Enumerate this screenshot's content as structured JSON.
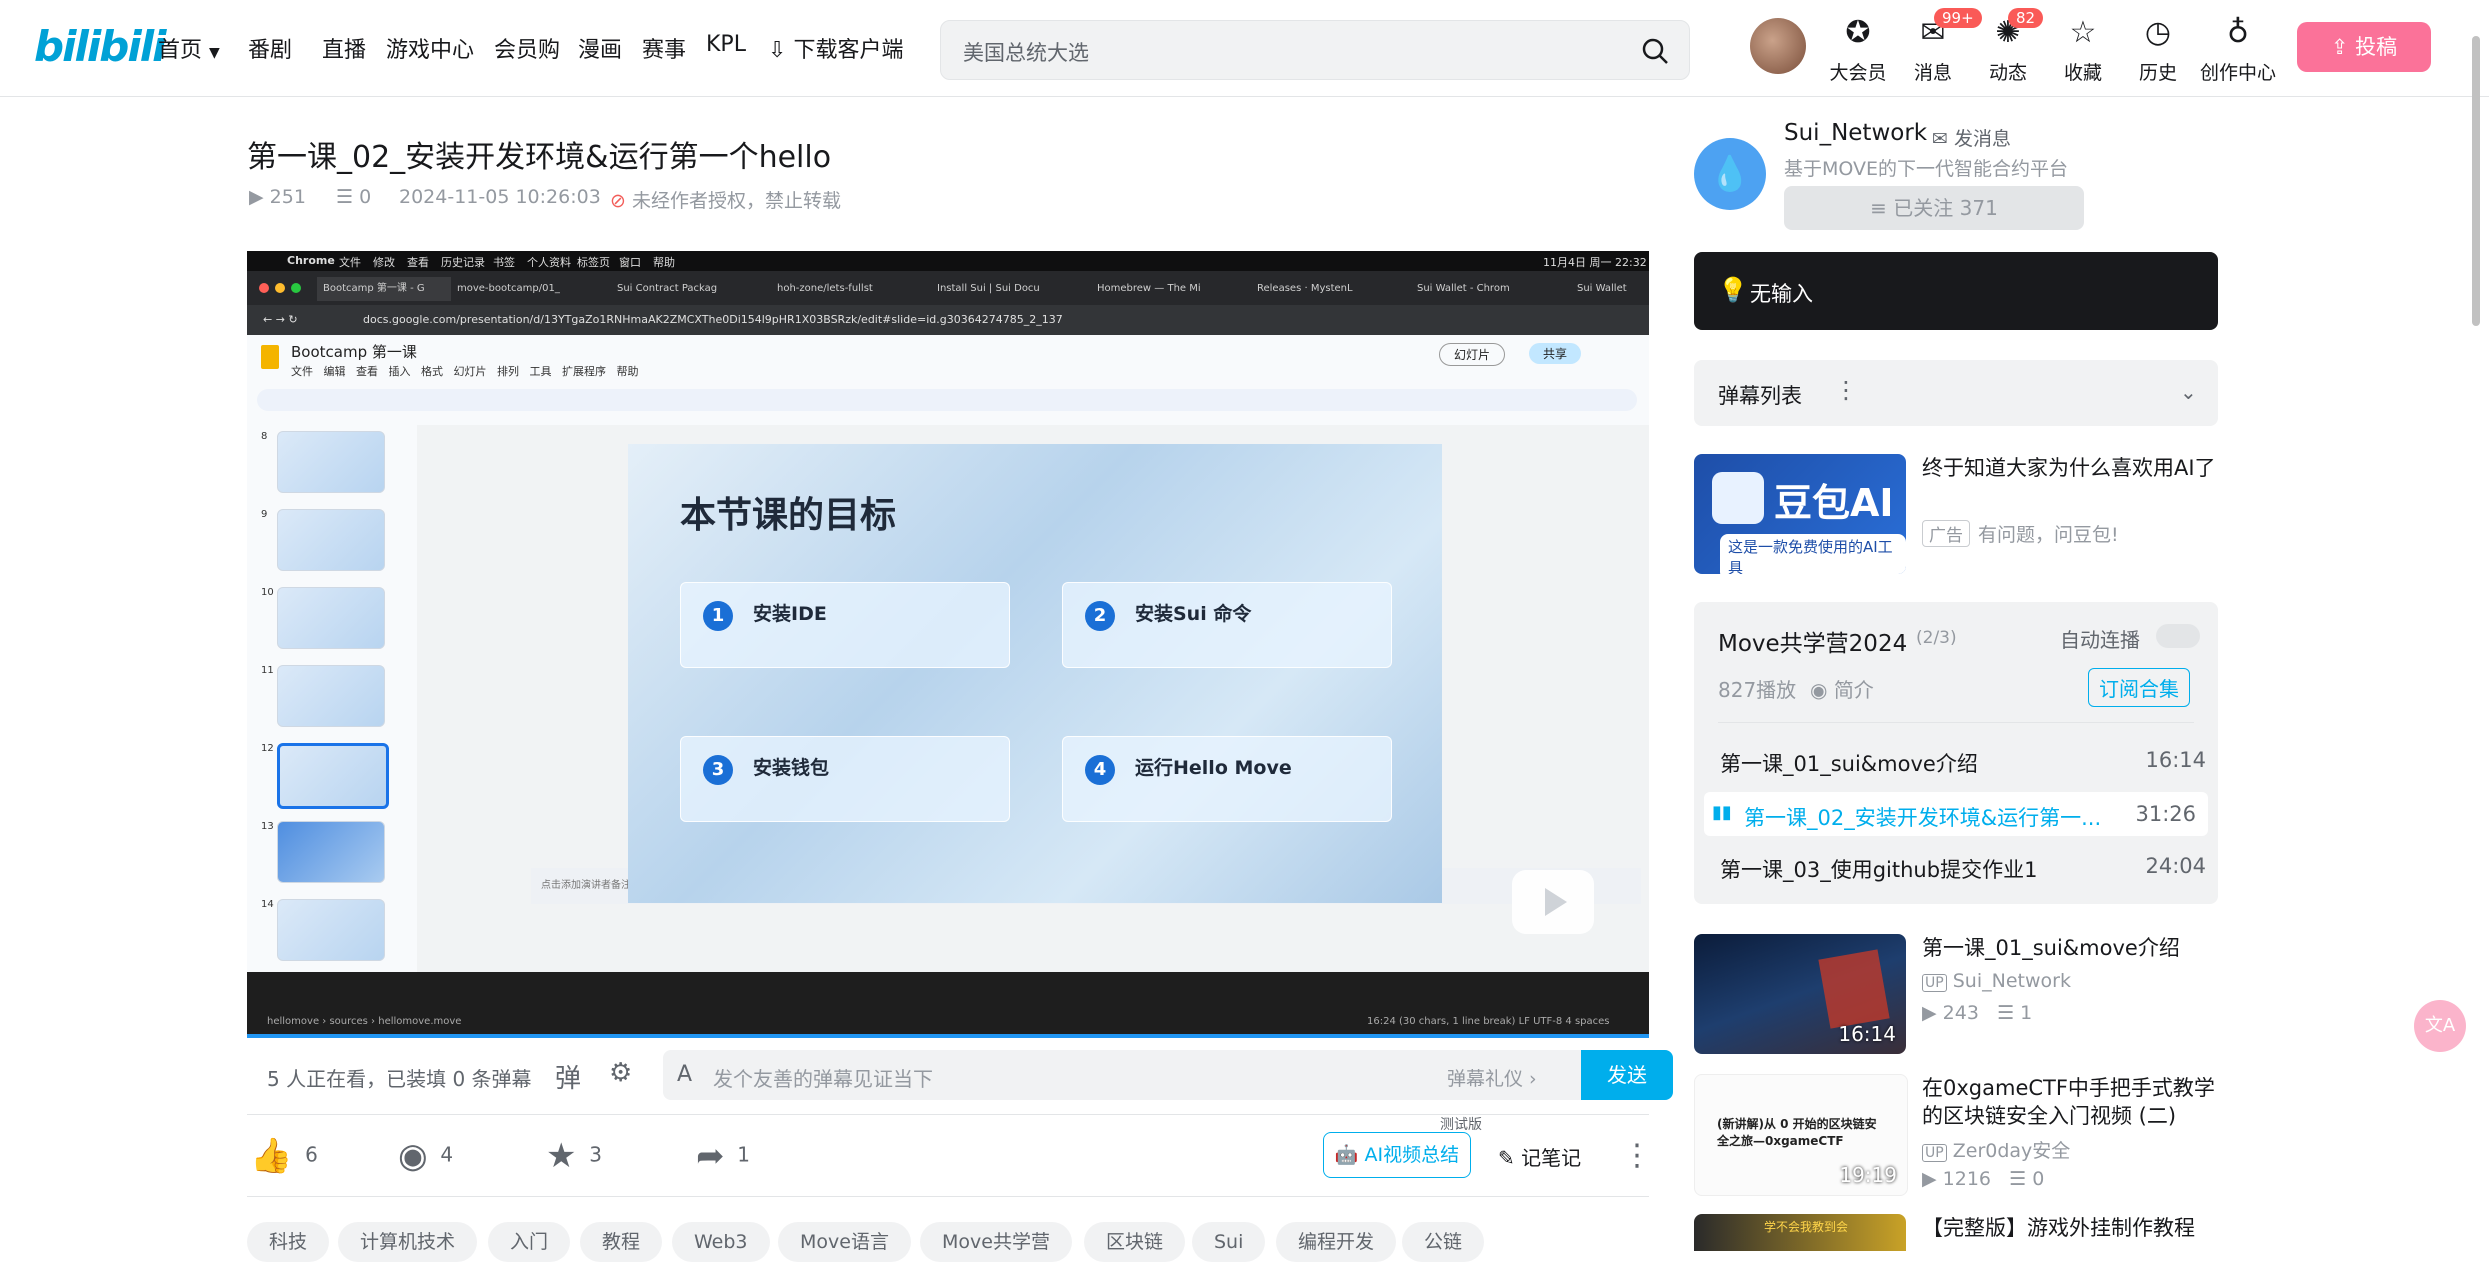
{
  "header": {
    "logo": "bilibili",
    "nav": [
      "首页",
      "番剧",
      "直播",
      "游戏中心",
      "会员购",
      "漫画",
      "赛事",
      "KPL",
      "下载客户端"
    ],
    "search_placeholder": "美国总统大选",
    "icons": [
      {
        "label": "大会员",
        "icon": "vip-icon"
      },
      {
        "label": "消息",
        "icon": "message-icon",
        "badge": "99+"
      },
      {
        "label": "动态",
        "icon": "dynamic-icon",
        "badge": "82"
      },
      {
        "label": "收藏",
        "icon": "star-icon"
      },
      {
        "label": "历史",
        "icon": "history-icon"
      },
      {
        "label": "创作中心",
        "icon": "creator-icon"
      }
    ],
    "upload_label": "投稿"
  },
  "video": {
    "title": "第一课_02_安装开发环境&运行第一个hello",
    "views": "251",
    "danmaku": "0",
    "date": "2024-11-05 10:26:03",
    "copyright": "未经作者授权，禁止转载"
  },
  "player": {
    "mac_menu": [
      "Chrome",
      "文件",
      "修改",
      "查看",
      "历史记录",
      "书签",
      "个人资料",
      "标签页",
      "窗口",
      "帮助"
    ],
    "mac_clock": "11月4日 周一 22:32",
    "tabs": [
      "Bootcamp 第一课 - G",
      "move-bootcamp/01_",
      "Sui Contract Packag",
      "hoh-zone/lets-fullst",
      "Install Sui | Sui Docu",
      "Homebrew — The Mi",
      "Releases · MystenL",
      "Sui Wallet - Chrom",
      "Sui Wallet"
    ],
    "url": "docs.google.com/presentation/d/13YTgaZo1RNHmaAK2ZMCXThe0Di154l9pHR1X03BSRzk/edit#slide=id.g30364274785_2_137",
    "doc_title": "Bootcamp 第一课",
    "doc_menu": [
      "文件",
      "编辑",
      "查看",
      "插入",
      "格式",
      "幻灯片",
      "排列",
      "工具",
      "扩展程序",
      "帮助"
    ],
    "slideshow_label": "幻灯片",
    "share_label": "共享",
    "thumb_numbers": [
      "8",
      "9",
      "10",
      "11",
      "12",
      "13",
      "14"
    ],
    "slide_title": "本节课的目标",
    "cards": [
      {
        "num": "1",
        "label": "安装IDE"
      },
      {
        "num": "2",
        "label": "安装Sui 命令"
      },
      {
        "num": "3",
        "label": "安装钱包"
      },
      {
        "num": "4",
        "label": "运行Hello Move"
      }
    ],
    "speaker_notes": "点击添加演讲者备注",
    "code_path": "hellomove › sources › hellomove.move",
    "code_status": "16:24 (30 chars, 1 line break)   LF   UTF-8   4 spaces"
  },
  "danmaku_bar": {
    "watching": "5 人正在看，已装填 0 条弹幕",
    "placeholder": "发个友善的弹幕见证当下",
    "etiquette": "弹幕礼仪 ›",
    "send": "发送"
  },
  "actions": {
    "like": "6",
    "coin": "4",
    "fav": "3",
    "share": "1",
    "ai_beta": "测试版",
    "ai_summary": "AI视频总结",
    "notes": "记笔记"
  },
  "tags": [
    "科技",
    "计算机技术",
    "入门",
    "教程",
    "Web3",
    "Move语言",
    "Move共学营",
    "区块链",
    "Sui",
    "编程开发",
    "公链"
  ],
  "uploader": {
    "name": "Sui_Network",
    "message": "发消息",
    "desc": "基于MOVE的下一代智能合约平台",
    "follow": "≡ 已关注 371"
  },
  "ai_box": {
    "label": "无输入"
  },
  "danmaku_list": {
    "label": "弹幕列表"
  },
  "ad": {
    "title": "终于知道大家为什么喜欢用AI了",
    "tag": "广告",
    "sub": "有问题，问豆包!",
    "img_text": "豆包AI",
    "img_sub": "这是一款免费使用的AI工具"
  },
  "series": {
    "title": "Move共学营2024",
    "count": "(2/3)",
    "autoplay": "自动连播",
    "plays": "827播放",
    "intro": "简介",
    "subscribe": "订阅合集",
    "episodes": [
      {
        "title": "第一课_01_sui&move介绍",
        "time": "16:14"
      },
      {
        "title": "第一课_02_安装开发环境&运行第一...",
        "time": "31:26"
      },
      {
        "title": "第一课_03_使用github提交作业1",
        "time": "24:04"
      }
    ]
  },
  "recommend": [
    {
      "title": "第一课_01_sui&move介绍",
      "up": "Sui_Network",
      "views": "243",
      "dm": "1",
      "duration": "16:14"
    },
    {
      "title": "在0xgameCTF中手把手式教学的区块链安全入门视频 (二)",
      "up": "Zer0day安全",
      "views": "1216",
      "dm": "0",
      "duration": "19:19",
      "thumb_text": "(新讲解)从 0 开始的区块链安全之旅—0xgameCTF"
    },
    {
      "title": "【完整版】游戏外挂制作教程",
      "thumb_text": "学不会我教到会"
    }
  ],
  "colors": {
    "brand": "#00a1d6",
    "accent": "#00aeec",
    "pink": "#fb7299"
  }
}
